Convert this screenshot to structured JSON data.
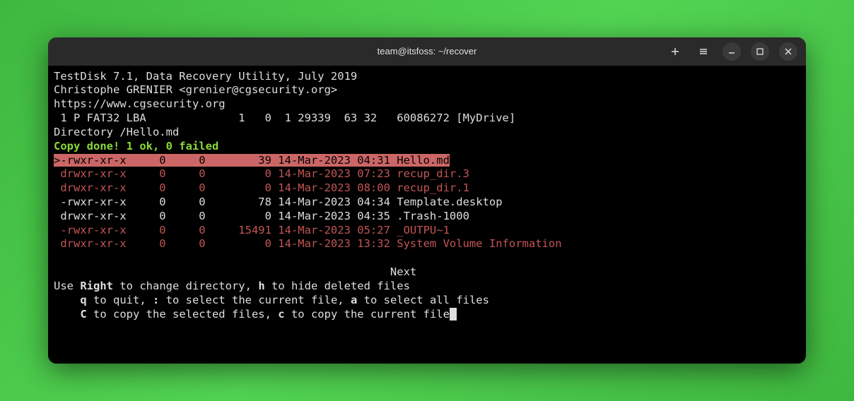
{
  "titlebar": {
    "title": "team@itsfoss: ~/recover"
  },
  "header": {
    "l1": "TestDisk 7.1, Data Recovery Utility, July 2019",
    "l2": "Christophe GRENIER <grenier@cgsecurity.org>",
    "l3": "https://www.cgsecurity.org",
    "l4": " 1 P FAT32 LBA              1   0  1 29339  63 32   60086272 [MyDrive]",
    "l5": "Directory /Hello.md",
    "status": "Copy done! 1 ok, 0 failed"
  },
  "rows": {
    "r0": ">-rwxr-xr-x     0     0        39 14-Mar-2023 04:31 Hello.md",
    "r1": " drwxr-xr-x     0     0         0 14-Mar-2023 07:23 recup_dir.3",
    "r2": " drwxr-xr-x     0     0         0 14-Mar-2023 08:00 recup_dir.1",
    "r3": " -rwxr-xr-x     0     0        78 14-Mar-2023 04:34 Template.desktop",
    "r4": " drwxr-xr-x     0     0         0 14-Mar-2023 04:35 .Trash-1000",
    "r5": " -rwxr-xr-x     0     0     15491 14-Mar-2023 05:27 _OUTPU~1",
    "r6": " drwxr-xr-x     0     0         0 14-Mar-2023 13:32 System Volume Information"
  },
  "footer": {
    "next": "                                                   Next",
    "h1a": "Use ",
    "h1b": "Right",
    "h1c": " to change directory, ",
    "h1d": "h",
    "h1e": " to hide deleted files",
    "h2a": "    ",
    "h2b": "q",
    "h2c": " to quit, ",
    "h2d": ":",
    "h2e": " to select the current file, ",
    "h2f": "a",
    "h2g": " to select all files",
    "h3a": "    ",
    "h3b": "C",
    "h3c": " to copy the selected files, ",
    "h3d": "c",
    "h3e": " to copy the current file"
  }
}
